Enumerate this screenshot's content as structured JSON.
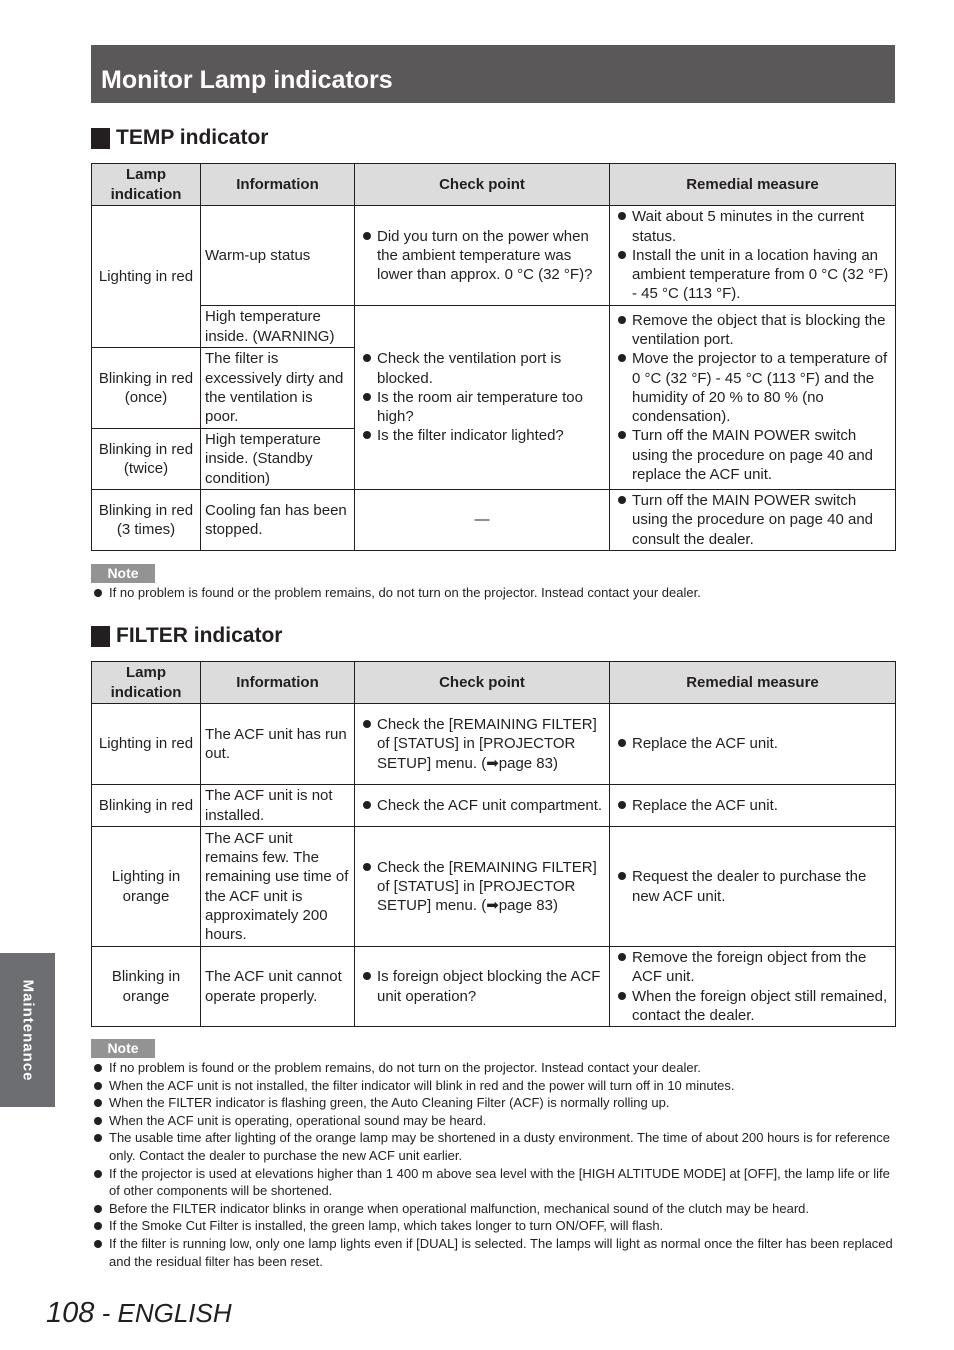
{
  "page_title": "Monitor Lamp indicators",
  "side_tab": "Maintenance",
  "footer": {
    "page_number": "108",
    "separator": " - ",
    "language": "ENGLISH"
  },
  "columns": [
    "Lamp indication",
    "Information",
    "Check point",
    "Remedial measure"
  ],
  "temp": {
    "heading": "TEMP indicator",
    "rows": [
      {
        "lamp": "Lighting in red",
        "info": [
          "Warm-up status",
          "High temperature inside. (WARNING)"
        ]
      },
      {
        "lamp": "Blinking in red (once)",
        "info": "The filter is excessively dirty and the ventilation is poor."
      },
      {
        "lamp": "Blinking in red (twice)",
        "info": "High temperature inside. (Standby condition)"
      },
      {
        "lamp": "Blinking in red (3 times)",
        "info": "Cooling fan has been stopped."
      }
    ],
    "check_warmup": [
      "Did you turn on the power when the ambient temperature was lower than approx. 0 °C (32 °F)?"
    ],
    "remedy_warmup": [
      "Wait about 5 minutes in the current status.",
      "Install the unit in a location having an ambient temperature from 0 °C (32 °F) - 45 °C (113 °F)."
    ],
    "check_high": [
      "Check the ventilation port is blocked.",
      "Is the room air temperature too high?",
      "Is the filter indicator lighted?"
    ],
    "remedy_high": [
      "Remove the object that is blocking the ventilation port.",
      "Move the projector to a temperature of 0 °C (32 °F) - 45 °C (113 °F) and the humidity of 20 % to 80 % (no condensation).",
      "Turn off the MAIN POWER switch using the procedure on page 40 and replace the ACF unit."
    ],
    "check_fan": "—",
    "remedy_fan": [
      "Turn off the MAIN POWER switch using the procedure on page 40 and consult the dealer."
    ]
  },
  "note1": {
    "label": "Note",
    "items": [
      "If no problem is found or the problem remains, do not turn on the projector. Instead contact your dealer."
    ]
  },
  "filter": {
    "heading": "FILTER indicator",
    "rows": [
      {
        "lamp": "Lighting in red",
        "info": "The ACF unit has run out.",
        "check": [
          "Check the [REMAINING FILTER] of [STATUS] in [PROJECTOR SETUP] menu. (➡page 83)"
        ],
        "remedy": [
          "Replace the ACF unit."
        ]
      },
      {
        "lamp": "Blinking in red",
        "info": "The ACF unit is not installed.",
        "check": [
          "Check the ACF unit compartment."
        ],
        "remedy": [
          "Replace the ACF unit."
        ]
      },
      {
        "lamp": "Lighting in orange",
        "info": "The ACF unit remains few. The remaining use time of the ACF unit is approximately 200 hours.",
        "check": [
          "Check the [REMAINING FILTER] of [STATUS] in [PROJECTOR SETUP] menu. (➡page 83)"
        ],
        "remedy": [
          "Request the dealer to purchase the new ACF unit."
        ]
      },
      {
        "lamp": "Blinking in orange",
        "info": "The ACF unit cannot operate properly.",
        "check": [
          "Is foreign object blocking the ACF unit operation?"
        ],
        "remedy": [
          "Remove the foreign object from the ACF unit.",
          "When the foreign object still remained, contact the dealer."
        ]
      }
    ]
  },
  "note2": {
    "label": "Note",
    "items": [
      "If no problem is found or the problem remains, do not turn on the projector. Instead contact your dealer.",
      "When the ACF unit is not installed, the filter indicator will blink in red and the power will turn off in 10 minutes.",
      "When the FILTER indicator is flashing green, the Auto Cleaning Filter (ACF) is normally rolling up.",
      "When the ACF unit is operating, operational sound may be heard.",
      "The usable time after lighting of the orange lamp may be shortened in a dusty environment. The time of about 200 hours is for reference only. Contact the dealer to purchase the new ACF unit earlier.",
      "If the projector is used at elevations higher than 1 400 m above sea level with the [HIGH ALTITUDE MODE] at [OFF], the lamp life or life of other components will be shortened.",
      "Before the FILTER indicator blinks in orange when operational malfunction, mechanical sound of the clutch may be heard.",
      "If the Smoke Cut Filter is installed, the green lamp, which takes longer to turn ON/OFF, will flash.",
      "If the filter is running low, only one lamp lights even if [DUAL] is selected. The lamps will light as normal once the filter has been replaced and the residual filter has been reset."
    ]
  }
}
